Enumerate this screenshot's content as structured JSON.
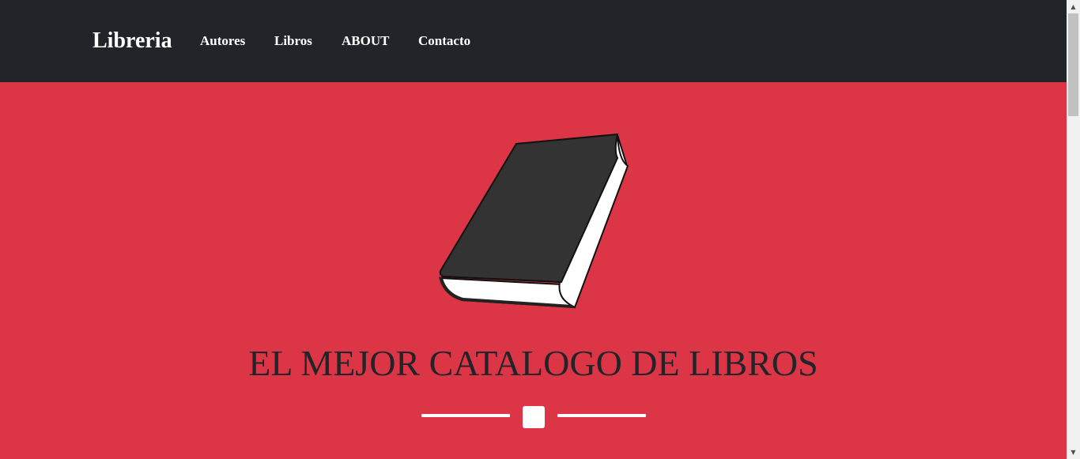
{
  "navbar": {
    "brand": "Libreria",
    "links": [
      "Autores",
      "Libros",
      "ABOUT",
      "Contacto"
    ]
  },
  "hero": {
    "image_icon": "book-icon",
    "headline": "EL MEJOR CATALOGO DE LIBROS",
    "divider_icon": "star-icon"
  },
  "colors": {
    "navbar_bg": "#212529",
    "hero_bg": "#dc3545",
    "headline": "#212529",
    "nav_text": "#ffffff"
  },
  "scrollbar": {
    "up_icon": "arrow-up-icon",
    "down_icon": "arrow-down-icon"
  }
}
